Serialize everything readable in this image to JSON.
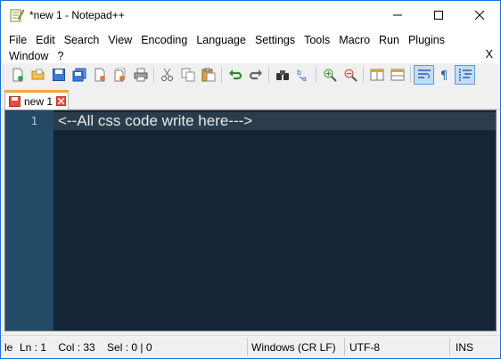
{
  "window": {
    "title": "*new 1 - Notepad++"
  },
  "menu": {
    "row1": [
      "File",
      "Edit",
      "Search",
      "View",
      "Encoding",
      "Language",
      "Settings",
      "Tools",
      "Macro",
      "Run",
      "Plugins"
    ],
    "row2": [
      "Window",
      "?"
    ],
    "close_doc": "X"
  },
  "toolbar": {
    "icons": [
      "new-file-icon",
      "open-file-icon",
      "save-icon",
      "save-all-icon",
      "close-icon",
      "close-all-icon",
      "print-icon",
      "cut-icon",
      "copy-icon",
      "paste-icon",
      "undo-icon",
      "redo-icon",
      "find-icon",
      "replace-icon",
      "zoom-in-icon",
      "zoom-out-icon",
      "sync-vertical-icon",
      "sync-horizontal-icon",
      "word-wrap-icon",
      "show-all-chars-icon",
      "indent-guide-icon"
    ]
  },
  "tabs": [
    {
      "label": "new 1",
      "active": true
    }
  ],
  "editor": {
    "lines": [
      {
        "number": "1",
        "text": "<--All css code write here--->"
      }
    ]
  },
  "status": {
    "length": "le",
    "position": "Ln : 1    Col : 33    Sel : 0 | 0",
    "eol": "Windows (CR LF)",
    "encoding": "UTF-8",
    "mode": "INS"
  },
  "colors": {
    "editor_bg": "#132537",
    "gutter_bg": "#234a67",
    "tab_accent": "#f4a73b",
    "window_border": "#1e6fd9"
  }
}
